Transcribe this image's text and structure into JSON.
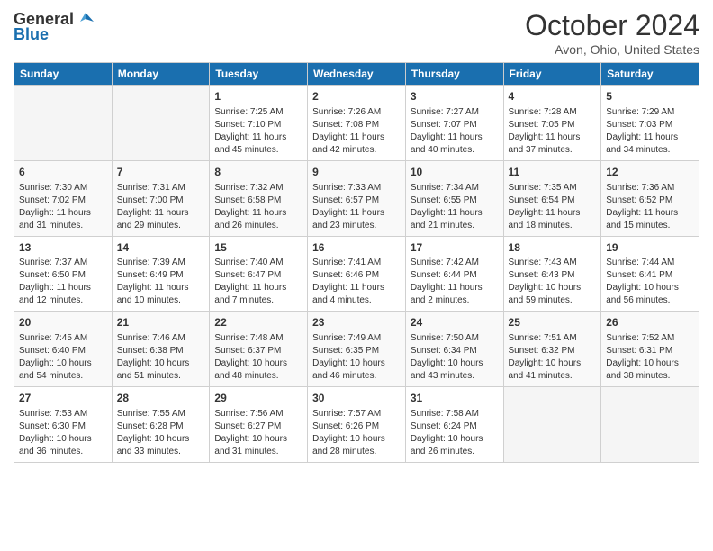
{
  "header": {
    "logo_general": "General",
    "logo_blue": "Blue",
    "month_title": "October 2024",
    "location": "Avon, Ohio, United States"
  },
  "weekdays": [
    "Sunday",
    "Monday",
    "Tuesday",
    "Wednesday",
    "Thursday",
    "Friday",
    "Saturday"
  ],
  "weeks": [
    [
      {
        "day": "",
        "info": ""
      },
      {
        "day": "",
        "info": ""
      },
      {
        "day": "1",
        "info": "Sunrise: 7:25 AM\nSunset: 7:10 PM\nDaylight: 11 hours and 45 minutes."
      },
      {
        "day": "2",
        "info": "Sunrise: 7:26 AM\nSunset: 7:08 PM\nDaylight: 11 hours and 42 minutes."
      },
      {
        "day": "3",
        "info": "Sunrise: 7:27 AM\nSunset: 7:07 PM\nDaylight: 11 hours and 40 minutes."
      },
      {
        "day": "4",
        "info": "Sunrise: 7:28 AM\nSunset: 7:05 PM\nDaylight: 11 hours and 37 minutes."
      },
      {
        "day": "5",
        "info": "Sunrise: 7:29 AM\nSunset: 7:03 PM\nDaylight: 11 hours and 34 minutes."
      }
    ],
    [
      {
        "day": "6",
        "info": "Sunrise: 7:30 AM\nSunset: 7:02 PM\nDaylight: 11 hours and 31 minutes."
      },
      {
        "day": "7",
        "info": "Sunrise: 7:31 AM\nSunset: 7:00 PM\nDaylight: 11 hours and 29 minutes."
      },
      {
        "day": "8",
        "info": "Sunrise: 7:32 AM\nSunset: 6:58 PM\nDaylight: 11 hours and 26 minutes."
      },
      {
        "day": "9",
        "info": "Sunrise: 7:33 AM\nSunset: 6:57 PM\nDaylight: 11 hours and 23 minutes."
      },
      {
        "day": "10",
        "info": "Sunrise: 7:34 AM\nSunset: 6:55 PM\nDaylight: 11 hours and 21 minutes."
      },
      {
        "day": "11",
        "info": "Sunrise: 7:35 AM\nSunset: 6:54 PM\nDaylight: 11 hours and 18 minutes."
      },
      {
        "day": "12",
        "info": "Sunrise: 7:36 AM\nSunset: 6:52 PM\nDaylight: 11 hours and 15 minutes."
      }
    ],
    [
      {
        "day": "13",
        "info": "Sunrise: 7:37 AM\nSunset: 6:50 PM\nDaylight: 11 hours and 12 minutes."
      },
      {
        "day": "14",
        "info": "Sunrise: 7:39 AM\nSunset: 6:49 PM\nDaylight: 11 hours and 10 minutes."
      },
      {
        "day": "15",
        "info": "Sunrise: 7:40 AM\nSunset: 6:47 PM\nDaylight: 11 hours and 7 minutes."
      },
      {
        "day": "16",
        "info": "Sunrise: 7:41 AM\nSunset: 6:46 PM\nDaylight: 11 hours and 4 minutes."
      },
      {
        "day": "17",
        "info": "Sunrise: 7:42 AM\nSunset: 6:44 PM\nDaylight: 11 hours and 2 minutes."
      },
      {
        "day": "18",
        "info": "Sunrise: 7:43 AM\nSunset: 6:43 PM\nDaylight: 10 hours and 59 minutes."
      },
      {
        "day": "19",
        "info": "Sunrise: 7:44 AM\nSunset: 6:41 PM\nDaylight: 10 hours and 56 minutes."
      }
    ],
    [
      {
        "day": "20",
        "info": "Sunrise: 7:45 AM\nSunset: 6:40 PM\nDaylight: 10 hours and 54 minutes."
      },
      {
        "day": "21",
        "info": "Sunrise: 7:46 AM\nSunset: 6:38 PM\nDaylight: 10 hours and 51 minutes."
      },
      {
        "day": "22",
        "info": "Sunrise: 7:48 AM\nSunset: 6:37 PM\nDaylight: 10 hours and 48 minutes."
      },
      {
        "day": "23",
        "info": "Sunrise: 7:49 AM\nSunset: 6:35 PM\nDaylight: 10 hours and 46 minutes."
      },
      {
        "day": "24",
        "info": "Sunrise: 7:50 AM\nSunset: 6:34 PM\nDaylight: 10 hours and 43 minutes."
      },
      {
        "day": "25",
        "info": "Sunrise: 7:51 AM\nSunset: 6:32 PM\nDaylight: 10 hours and 41 minutes."
      },
      {
        "day": "26",
        "info": "Sunrise: 7:52 AM\nSunset: 6:31 PM\nDaylight: 10 hours and 38 minutes."
      }
    ],
    [
      {
        "day": "27",
        "info": "Sunrise: 7:53 AM\nSunset: 6:30 PM\nDaylight: 10 hours and 36 minutes."
      },
      {
        "day": "28",
        "info": "Sunrise: 7:55 AM\nSunset: 6:28 PM\nDaylight: 10 hours and 33 minutes."
      },
      {
        "day": "29",
        "info": "Sunrise: 7:56 AM\nSunset: 6:27 PM\nDaylight: 10 hours and 31 minutes."
      },
      {
        "day": "30",
        "info": "Sunrise: 7:57 AM\nSunset: 6:26 PM\nDaylight: 10 hours and 28 minutes."
      },
      {
        "day": "31",
        "info": "Sunrise: 7:58 AM\nSunset: 6:24 PM\nDaylight: 10 hours and 26 minutes."
      },
      {
        "day": "",
        "info": ""
      },
      {
        "day": "",
        "info": ""
      }
    ]
  ]
}
